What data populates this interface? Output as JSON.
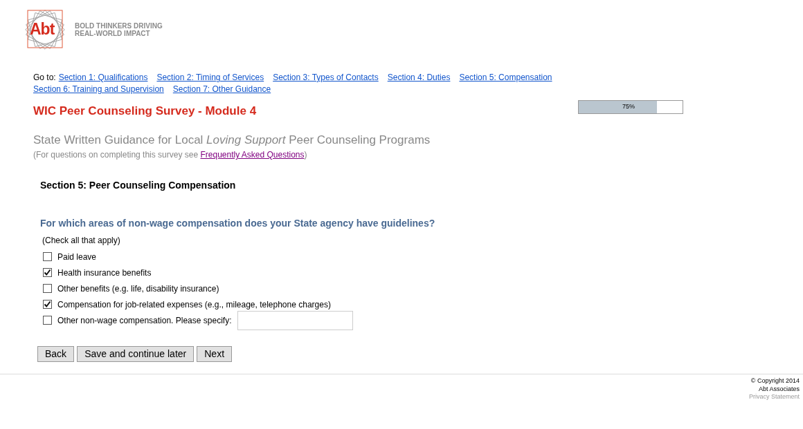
{
  "logo": {
    "mark": "Abt",
    "tagline": [
      "BOLD THINKERS DRIVING",
      "REAL-WORLD IMPACT"
    ]
  },
  "nav": {
    "label": "Go to:",
    "links": [
      "Section 1: Qualifications",
      "Section 2: Timing of Services",
      "Section 3: Types of Contacts",
      "Section 4: Duties",
      "Section 5: Compensation",
      "Section 6: Training and Supervision",
      "Section 7: Other Guidance"
    ]
  },
  "title": "WIC Peer Counseling Survey - Module 4",
  "progress": {
    "level": 0.75,
    "reading": "75%"
  },
  "subtitle": "State Written Guidance for Local *Loving Support* Peer Counseling Programs",
  "note": {
    "before": "(For questions on completing this survey see ",
    "link": "Frequently Asked Questions",
    "after": ")"
  },
  "section_heading": "Section 5: Peer Counseling Compensation",
  "question": "For which areas of non-wage compensation does your State agency have guidelines?",
  "instruction": "(Check all that apply)",
  "options": [
    {
      "label": "Paid leave",
      "checked": false
    },
    {
      "label": "Health insurance benefits",
      "checked": true
    },
    {
      "label": "Other benefits (e.g. life, disability insurance)",
      "checked": false
    },
    {
      "label": "Compensation for job-related expenses (e.g., mileage, telephone charges)",
      "checked": true
    },
    {
      "label": "Other non-wage compensation. Please specify:",
      "checked": false,
      "kind": "specify"
    }
  ],
  "buttons": [
    "Back",
    "Save and continue later",
    "Next"
  ],
  "footer": {
    "copyright": "© Copyright 2014",
    "company": "Abt Associates",
    "privacy": "Privacy Statement"
  }
}
